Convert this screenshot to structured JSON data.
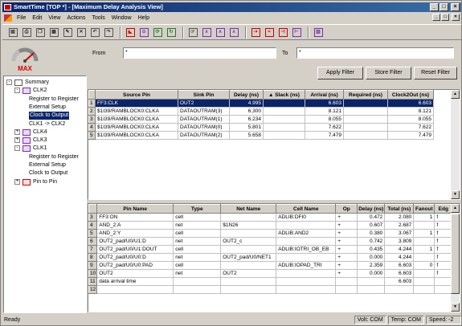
{
  "title": "SmartTime [TOP *] - [Maximum Delay Analysis View]",
  "window_buttons": {
    "minimize": "_",
    "maximize": "□",
    "close": "×"
  },
  "mdi_buttons": {
    "minimize": "_",
    "restore": "□",
    "close": "×"
  },
  "menu": [
    "File",
    "Edit",
    "View",
    "Actions",
    "Tools",
    "Window",
    "Help"
  ],
  "toolbar_icons": [
    "open-icon",
    "print-icon",
    "copy-icon",
    "paste-icon",
    "edit-icon",
    "delete-icon",
    "undo-icon",
    "redo-icon",
    "sep",
    "max-delay-icon",
    "clock-icon",
    "cycle-icon",
    "refresh-icon",
    "sep",
    "select-icon",
    "clock-a-icon",
    "clock-b-icon",
    "clock-c-icon",
    "sep",
    "path-icon",
    "net-icon",
    "setup-icon",
    "hold-icon",
    "sep",
    "report-icon"
  ],
  "logo_text": "MAX",
  "tree": [
    {
      "label": "Summary",
      "level": 0,
      "expander": "-",
      "icon": "summary-icon"
    },
    {
      "label": "CLK2",
      "level": 1,
      "expander": "-",
      "icon": "clock-icon"
    },
    {
      "label": "Register to Register",
      "level": 2
    },
    {
      "label": "External Setup",
      "level": 2
    },
    {
      "label": "Clock to Output",
      "level": 2,
      "selected": true
    },
    {
      "label": "CLK1 -> CLK2",
      "level": 2
    },
    {
      "label": "CLK4",
      "level": 1,
      "expander": "+",
      "icon": "clock-icon"
    },
    {
      "label": "CLK3",
      "level": 1,
      "expander": "+",
      "icon": "clock-icon"
    },
    {
      "label": "CLK1",
      "level": 1,
      "expander": "-",
      "icon": "clock-icon"
    },
    {
      "label": "Register to Register",
      "level": 2
    },
    {
      "label": "External Setup",
      "level": 2
    },
    {
      "label": "Clock to Output",
      "level": 2
    },
    {
      "label": "Pin to Pin",
      "level": 1,
      "expander": "+",
      "icon": "pin-icon"
    }
  ],
  "filter": {
    "from_label": "From",
    "from_value": "*",
    "to_label": "To",
    "to_value": "*",
    "apply": "Apply Filter",
    "store": "Store Filter",
    "reset": "Reset Filter"
  },
  "paths_table": {
    "headers": [
      "",
      "Source Pin",
      "Sink Pin",
      "Delay (ns)",
      "▲ Slack (ns)",
      "Arrival (ns)",
      "Required (ns)",
      "Clock2Out (ns)"
    ],
    "rows": [
      {
        "n": "1",
        "source": "FF3:CLK",
        "sink": "OUT2",
        "delay": "4.995",
        "slack": "",
        "arrival": "6.603",
        "required": "",
        "c2o": "6.603",
        "selected": true
      },
      {
        "n": "2",
        "source": "$1I39/RAMBLOCK0:CLKA",
        "sink": "DATAOUTRAM(3)",
        "delay": "6.300",
        "slack": "",
        "arrival": "8.121",
        "required": "",
        "c2o": "8.121"
      },
      {
        "n": "3",
        "source": "$1I39/RAMBLOCK0:CLKA",
        "sink": "DATAOUTRAM(1)",
        "delay": "6.234",
        "slack": "",
        "arrival": "8.055",
        "required": "",
        "c2o": "8.055"
      },
      {
        "n": "4",
        "source": "$1I39/RAMBLOCK0:CLKA",
        "sink": "DATAOUTRAM(0)",
        "delay": "5.801",
        "slack": "",
        "arrival": "7.622",
        "required": "",
        "c2o": "7.622"
      },
      {
        "n": "5",
        "source": "$1I39/RAMBLOCK0:CLKA",
        "sink": "DATAOUTRAM(2)",
        "delay": "5.658",
        "slack": "",
        "arrival": "7.479",
        "required": "",
        "c2o": "7.479"
      }
    ]
  },
  "details_table": {
    "headers": [
      "",
      "Pin Name",
      "Type",
      "Net Name",
      "Cell Name",
      "Op",
      "Delay (ns)",
      "Total (ns)",
      "Fanout",
      "Edg"
    ],
    "rows": [
      {
        "n": "3",
        "pin": "FF3:ON",
        "type": "cell",
        "net": "",
        "cell": "ADLIB:DFI0",
        "op": "+",
        "delay": "0.472",
        "total": "2.080",
        "fanout": "1",
        "edge": "f"
      },
      {
        "n": "4",
        "pin": "AND_2:A",
        "type": "net",
        "net": "$1N26",
        "cell": "",
        "op": "+",
        "delay": "0.607",
        "total": "2.687",
        "fanout": "",
        "edge": "f"
      },
      {
        "n": "5",
        "pin": "AND_2:Y",
        "type": "cell",
        "net": "",
        "cell": "ADLIB:AND2",
        "op": "+",
        "delay": "0.380",
        "total": "3.067",
        "fanout": "1",
        "edge": "f"
      },
      {
        "n": "6",
        "pin": "OUT2_pad/U0/U1:D",
        "type": "net",
        "net": "OUT2_c",
        "cell": "",
        "op": "+",
        "delay": "0.742",
        "total": "3.809",
        "fanout": "",
        "edge": "f"
      },
      {
        "n": "7",
        "pin": "OUT2_pad/U0/U1:DOUT",
        "type": "cell",
        "net": "",
        "cell": "ADLIB:IOTRI_OB_EB",
        "op": "+",
        "delay": "0.435",
        "total": "4.244",
        "fanout": "1",
        "edge": "f"
      },
      {
        "n": "8",
        "pin": "OUT2_pad/U0/U0:D",
        "type": "net",
        "net": "OUT2_pad/U0/NET1",
        "cell": "",
        "op": "+",
        "delay": "0.000",
        "total": "4.244",
        "fanout": "",
        "edge": "f"
      },
      {
        "n": "9",
        "pin": "OUT2_pad/U0/U0:PAD",
        "type": "cell",
        "net": "",
        "cell": "ADLIB:IOPAD_TRI",
        "op": "+",
        "delay": "2.359",
        "total": "6.603",
        "fanout": "0",
        "edge": "f"
      },
      {
        "n": "10",
        "pin": "OUT2",
        "type": "net",
        "net": "OUT2",
        "cell": "",
        "op": "+",
        "delay": "0.000",
        "total": "6.603",
        "fanout": "",
        "edge": "f"
      },
      {
        "n": "11",
        "pin": "data arrival time",
        "type": "",
        "net": "",
        "cell": "",
        "op": "",
        "delay": "",
        "total": "6.603",
        "fanout": "",
        "edge": ""
      },
      {
        "n": "12",
        "pin": "",
        "type": "",
        "net": "",
        "cell": "",
        "op": "",
        "delay": "",
        "total": "",
        "fanout": "",
        "edge": ""
      }
    ]
  },
  "status": {
    "ready": "Ready",
    "volt": "Volt: COM",
    "temp": "Temp: COM",
    "speed": "Speed: -2"
  },
  "colors": {
    "selection": "#0a246a",
    "title_start": "#0a246a",
    "title_end": "#3a6ea5",
    "clock_purple": "#7a2fa8"
  }
}
